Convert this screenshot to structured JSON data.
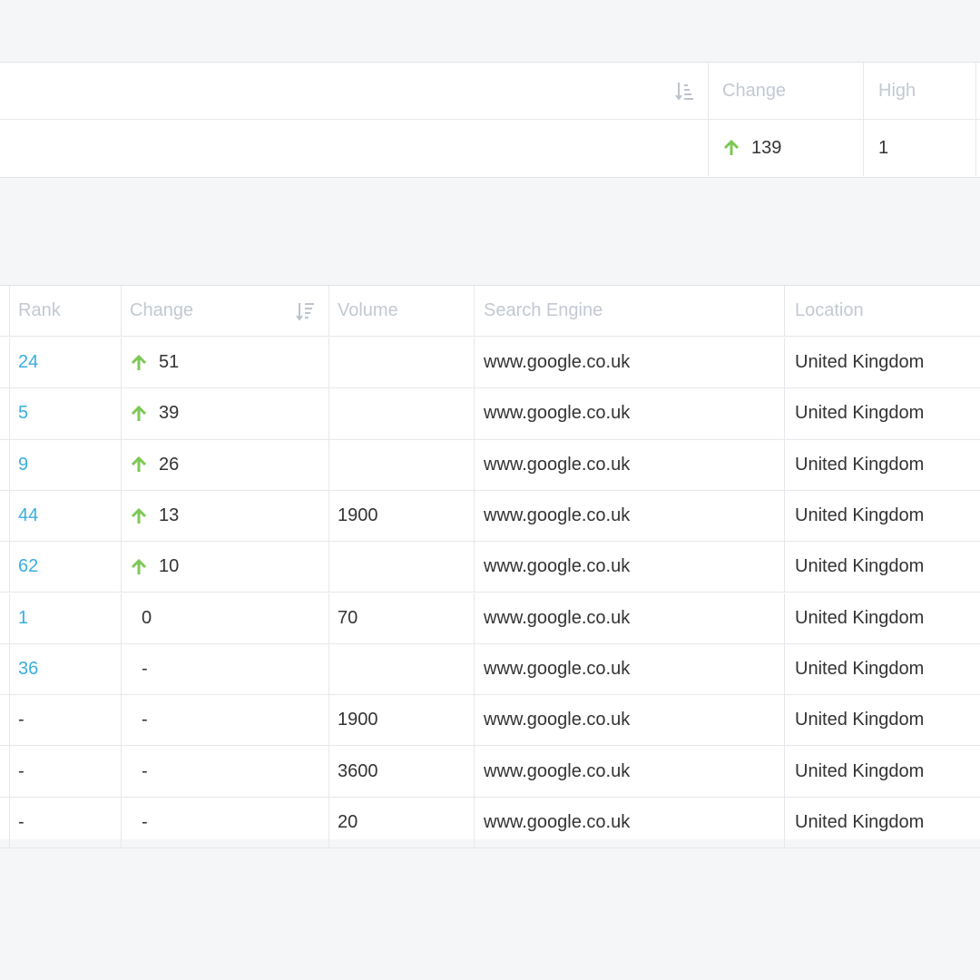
{
  "summary": {
    "headers": {
      "change": "Change",
      "high": "High"
    },
    "row": {
      "change": "139",
      "high": "1"
    }
  },
  "table": {
    "headers": {
      "rank": "Rank",
      "change": "Change",
      "volume": "Volume",
      "engine": "Search Engine",
      "location": "Location"
    },
    "rows": [
      {
        "rank": "24",
        "change": "51",
        "up": true,
        "volume": "",
        "engine": "www.google.co.uk",
        "location": "United Kingdom"
      },
      {
        "rank": "5",
        "change": "39",
        "up": true,
        "volume": "",
        "engine": "www.google.co.uk",
        "location": "United Kingdom"
      },
      {
        "rank": "9",
        "change": "26",
        "up": true,
        "volume": "",
        "engine": "www.google.co.uk",
        "location": "United Kingdom"
      },
      {
        "rank": "44",
        "change": "13",
        "up": true,
        "volume": "1900",
        "engine": "www.google.co.uk",
        "location": "United Kingdom"
      },
      {
        "rank": "62",
        "change": "10",
        "up": true,
        "volume": "",
        "engine": "www.google.co.uk",
        "location": "United Kingdom"
      },
      {
        "rank": "1",
        "change": "0",
        "up": false,
        "volume": "70",
        "engine": "www.google.co.uk",
        "location": "United Kingdom"
      },
      {
        "rank": "36",
        "change": "-",
        "up": false,
        "volume": "",
        "engine": "www.google.co.uk",
        "location": "United Kingdom"
      },
      {
        "rank": "-",
        "change": "-",
        "up": false,
        "volume": "1900",
        "engine": "www.google.co.uk",
        "location": "United Kingdom"
      },
      {
        "rank": "-",
        "change": "-",
        "up": false,
        "volume": "3600",
        "engine": "www.google.co.uk",
        "location": "United Kingdom"
      },
      {
        "rank": "-",
        "change": "-",
        "up": false,
        "volume": "20",
        "engine": "www.google.co.uk",
        "location": "United Kingdom"
      }
    ]
  },
  "colors": {
    "link": "#3aaee0",
    "up_arrow": "#7dc855",
    "header_text": "#c3c9d2"
  },
  "icons": {
    "sort": "sort-descending-icon",
    "up": "arrow-up-icon"
  }
}
